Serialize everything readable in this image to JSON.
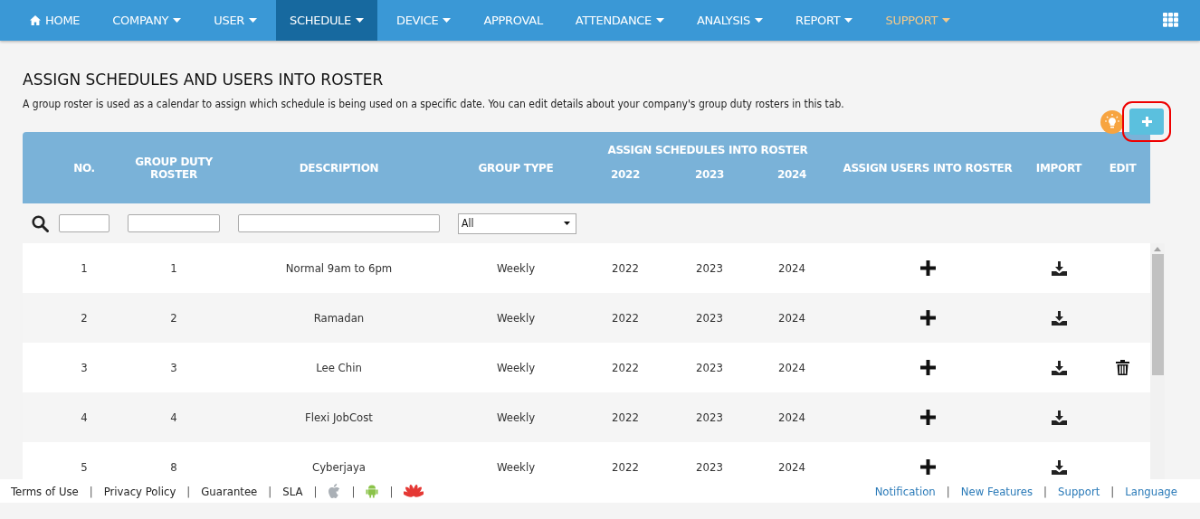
{
  "nav": {
    "items": [
      {
        "label": "HOME",
        "kind": "home",
        "dropdown": false,
        "selected": false,
        "highlighted": false
      },
      {
        "label": "COMPANY",
        "kind": "menu",
        "dropdown": true,
        "selected": false,
        "highlighted": false
      },
      {
        "label": "USER",
        "kind": "menu",
        "dropdown": true,
        "selected": false,
        "highlighted": false
      },
      {
        "label": "SCHEDULE",
        "kind": "menu",
        "dropdown": true,
        "selected": true,
        "highlighted": false
      },
      {
        "label": "DEVICE",
        "kind": "menu",
        "dropdown": true,
        "selected": false,
        "highlighted": false
      },
      {
        "label": "APPROVAL",
        "kind": "menu",
        "dropdown": false,
        "selected": false,
        "highlighted": false
      },
      {
        "label": "ATTENDANCE",
        "kind": "menu",
        "dropdown": true,
        "selected": false,
        "highlighted": false
      },
      {
        "label": "ANALYSIS",
        "kind": "menu",
        "dropdown": true,
        "selected": false,
        "highlighted": false
      },
      {
        "label": "REPORT",
        "kind": "menu",
        "dropdown": true,
        "selected": false,
        "highlighted": false
      },
      {
        "label": "SUPPORT",
        "kind": "menu",
        "dropdown": true,
        "selected": false,
        "highlighted": true
      }
    ]
  },
  "page": {
    "title": "ASSIGN SCHEDULES AND USERS INTO ROSTER",
    "description": "A group roster is used as a calendar to assign which schedule is being used on a specific date. You can edit details about your company's group duty rosters in this tab."
  },
  "table": {
    "columns": [
      "NO.",
      "GROUP DUTY ROSTER",
      "DESCRIPTION",
      "GROUP TYPE",
      "ASSIGN USERS INTO ROSTER",
      "IMPORT",
      "EDIT"
    ],
    "group_header": {
      "label": "ASSIGN SCHEDULES INTO ROSTER",
      "years": [
        "2022",
        "2023",
        "2024"
      ]
    },
    "filter": {
      "group_type": "All"
    },
    "rows": [
      {
        "no": "1",
        "roster": "1",
        "description": "Normal 9am to 6pm",
        "group_type": "Weekly",
        "years": [
          "2022",
          "2023",
          "2024"
        ],
        "deletable": false
      },
      {
        "no": "2",
        "roster": "2",
        "description": "Ramadan",
        "group_type": "Weekly",
        "years": [
          "2022",
          "2023",
          "2024"
        ],
        "deletable": false
      },
      {
        "no": "3",
        "roster": "3",
        "description": "Lee Chin",
        "group_type": "Weekly",
        "years": [
          "2022",
          "2023",
          "2024"
        ],
        "deletable": true
      },
      {
        "no": "4",
        "roster": "4",
        "description": "Flexi JobCost",
        "group_type": "Weekly",
        "years": [
          "2022",
          "2023",
          "2024"
        ],
        "deletable": false
      },
      {
        "no": "5",
        "roster": "8",
        "description": "Cyberjaya",
        "group_type": "Weekly",
        "years": [
          "2022",
          "2023",
          "2024"
        ],
        "deletable": false
      }
    ]
  },
  "footer": {
    "left": [
      {
        "kind": "link",
        "text": "Terms of Use"
      },
      {
        "kind": "separator",
        "text": "|"
      },
      {
        "kind": "link",
        "text": "Privacy Policy"
      },
      {
        "kind": "separator",
        "text": "|"
      },
      {
        "kind": "link",
        "text": "Guarantee"
      },
      {
        "kind": "separator",
        "text": "|"
      },
      {
        "kind": "link",
        "text": "SLA"
      },
      {
        "kind": "separator",
        "text": "|"
      },
      {
        "kind": "apple"
      },
      {
        "kind": "separator",
        "text": "|"
      },
      {
        "kind": "android"
      },
      {
        "kind": "separator",
        "text": "|"
      },
      {
        "kind": "flower"
      }
    ],
    "right": [
      {
        "kind": "link",
        "text": "Notification"
      },
      {
        "kind": "separator",
        "text": "|"
      },
      {
        "kind": "link",
        "text": "New Features"
      },
      {
        "kind": "separator",
        "text": "|"
      },
      {
        "kind": "link",
        "text": "Support"
      },
      {
        "kind": "separator",
        "text": "|"
      },
      {
        "kind": "link",
        "text": "Language"
      }
    ]
  }
}
